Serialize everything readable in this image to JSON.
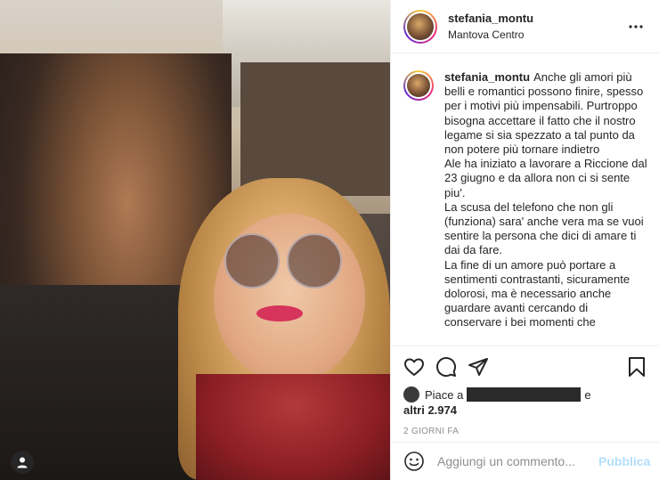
{
  "header": {
    "username": "stefania_montu",
    "location": "Mantova Centro",
    "more_icon": "more-horizontal-icon"
  },
  "caption": {
    "username": "stefania_montu",
    "paragraphs": [
      "Anche gli amori più belli e romantici possono finire, spesso per i motivi più impensabili. Purtroppo bisogna accettare il fatto che il nostro legame si sia spezzato a tal punto da non potere più tornare indietro",
      "Ale ha iniziato a lavorare a Riccione dal 23 giugno e da allora non ci si sente piu'.",
      "La scusa del telefono che non gli (funziona) sara' anche vera ma se vuoi sentire la persona che dici di amare ti dai da fare.",
      "La fine di un amore può portare a sentimenti contrastanti, sicuramente dolorosi, ma è necessario anche guardare avanti cercando di conservare i bei momenti che"
    ]
  },
  "actions": {
    "like_icon": "heart-icon",
    "comment_icon": "comment-icon",
    "share_icon": "send-icon",
    "save_icon": "bookmark-icon"
  },
  "likes": {
    "prefix": "Piace a",
    "suffix": "e",
    "others": "altri 2.974"
  },
  "timestamp": "2 GIORNI FA",
  "comment": {
    "placeholder": "Aggiungi un commento...",
    "publish_label": "Pubblica",
    "emoji_icon": "smiley-icon"
  },
  "photo": {
    "tag_icon": "user-tag-icon"
  }
}
